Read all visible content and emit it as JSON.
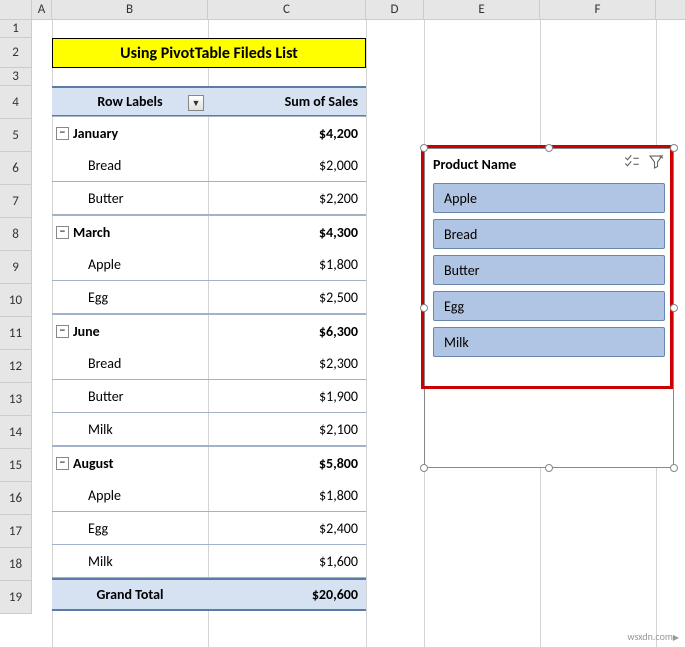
{
  "columns": [
    "A",
    "B",
    "C",
    "D",
    "E",
    "F"
  ],
  "title": "Using PivotTable Fileds List",
  "pivot": {
    "header_left": "Row Labels",
    "header_right": "Sum of Sales",
    "groups": [
      {
        "label": "January",
        "total": "$4,200",
        "items": [
          {
            "name": "Bread",
            "val": "$2,000"
          },
          {
            "name": "Butter",
            "val": "$2,200"
          }
        ]
      },
      {
        "label": "March",
        "total": "$4,300",
        "items": [
          {
            "name": "Apple",
            "val": "$1,800"
          },
          {
            "name": "Egg",
            "val": "$2,500"
          }
        ]
      },
      {
        "label": "June",
        "total": "$6,300",
        "items": [
          {
            "name": "Bread",
            "val": "$2,300"
          },
          {
            "name": "Butter",
            "val": "$1,900"
          },
          {
            "name": "Milk",
            "val": "$2,100"
          }
        ]
      },
      {
        "label": "August",
        "total": "$5,800",
        "items": [
          {
            "name": "Apple",
            "val": "$1,800"
          },
          {
            "name": "Egg",
            "val": "$2,400"
          },
          {
            "name": "Milk",
            "val": "$1,600"
          }
        ]
      }
    ],
    "grand_label": "Grand Total",
    "grand_value": "$20,600"
  },
  "slicer": {
    "title": "Product Name",
    "items": [
      "Apple",
      "Bread",
      "Butter",
      "Egg",
      "Milk"
    ]
  },
  "watermark": "wsxdn.com"
}
